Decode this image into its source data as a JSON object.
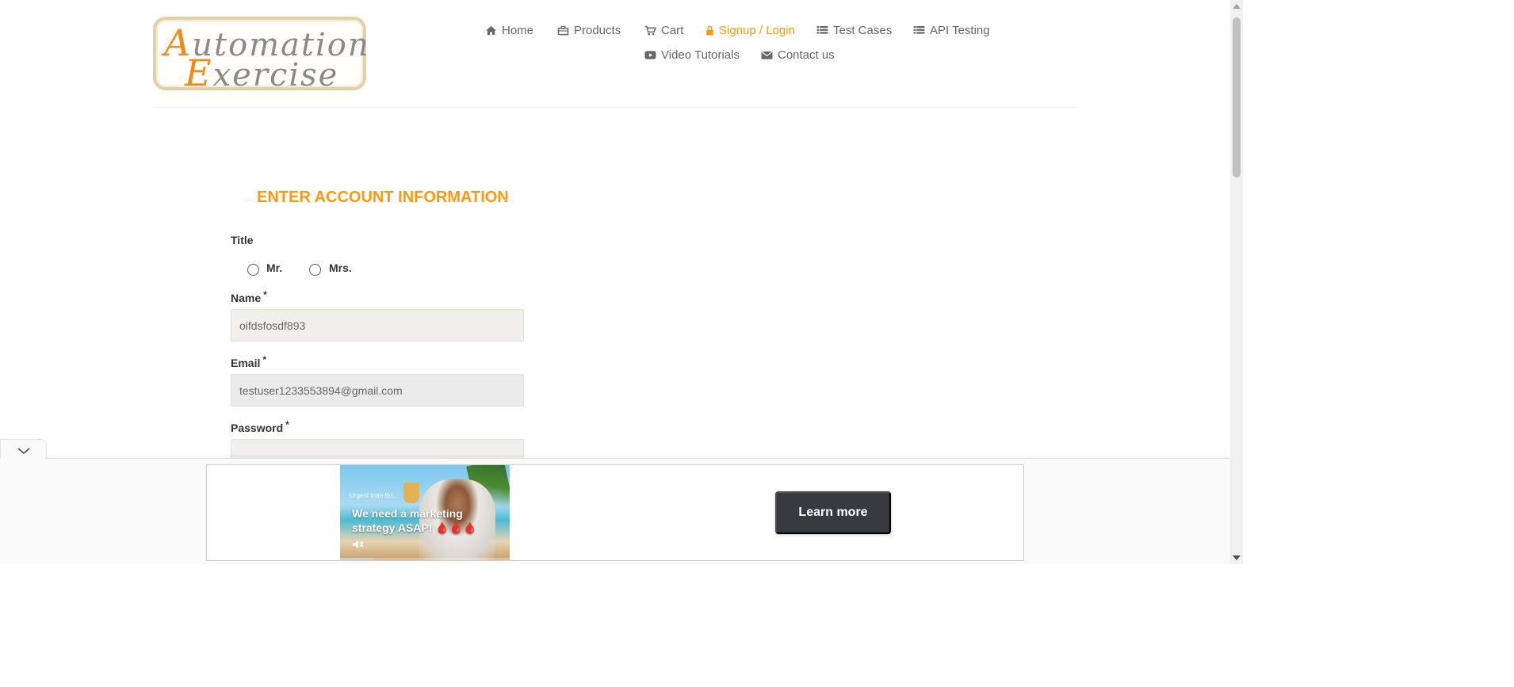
{
  "header": {
    "logo": {
      "line1_cap": "A",
      "line1_rest": "utomation",
      "line2_cap": "E",
      "line2_rest": "xercise",
      "cap_color": "#f28a1c"
    },
    "nav": [
      {
        "label": "Home",
        "icon": "home-icon"
      },
      {
        "label": "Products",
        "icon": "briefcase-icon"
      },
      {
        "label": "Cart",
        "icon": "cart-icon"
      },
      {
        "label": "Signup / Login",
        "icon": "lock-icon",
        "active": true
      },
      {
        "label": "Test Cases",
        "icon": "list-icon"
      },
      {
        "label": "API Testing",
        "icon": "list-icon"
      },
      {
        "label": "Video Tutorials",
        "icon": "youtube-icon"
      },
      {
        "label": "Contact us",
        "icon": "envelope-icon"
      }
    ],
    "active_color": "#fe980f"
  },
  "form": {
    "heading": "ENTER ACCOUNT INFORMATION",
    "title_label": "Title",
    "title_options": [
      {
        "label": "Mr.",
        "selected": false
      },
      {
        "label": "Mrs.",
        "selected": false
      }
    ],
    "required_marker": "*",
    "name": {
      "label": "Name",
      "value": "oifdsfosdf893"
    },
    "email": {
      "label": "Email",
      "value": "testuser1233553894@gmail.com"
    },
    "password": {
      "label": "Password",
      "value": ""
    }
  },
  "ad": {
    "badge_text": "Urgent from Bo...",
    "headline": "We need a marketing strategy ASAP! 🩸🩸🩸",
    "cta": "Learn more",
    "video_progress": 0.2
  }
}
